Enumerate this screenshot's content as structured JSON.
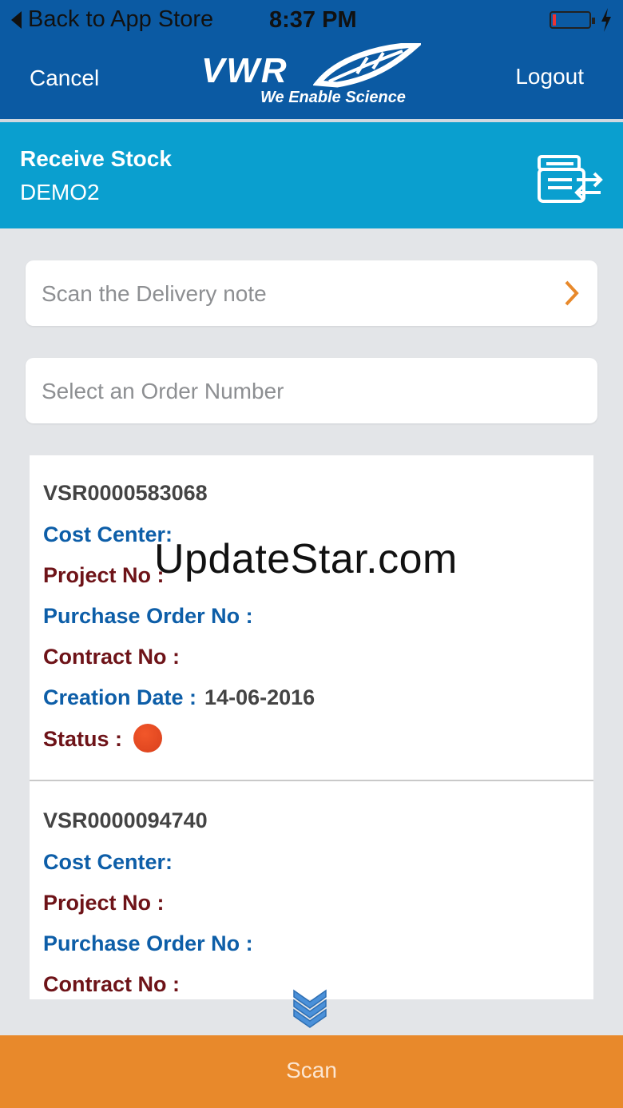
{
  "status_bar": {
    "back_label": "Back to App Store",
    "time": "8:37 PM",
    "battery_level": 0.1
  },
  "nav": {
    "cancel_label": "Cancel",
    "logout_label": "Logout",
    "logo_text": "VWR",
    "logo_tagline": "We Enable Science"
  },
  "header": {
    "title": "Receive Stock",
    "subtitle": "DEMO2",
    "action_icon": "transfer-icon"
  },
  "form": {
    "delivery_placeholder": "Scan the Delivery note",
    "order_placeholder": "Select an Order Number"
  },
  "orders": [
    {
      "id": "VSR0000583068",
      "cost_center_label": "Cost Center:",
      "cost_center_value": "",
      "project_label": "Project No :",
      "project_value": "",
      "po_label": "Purchase Order No :",
      "po_value": "",
      "contract_label": "Contract No :",
      "contract_value": "",
      "date_label": "Creation Date :",
      "date_value": "14-06-2016",
      "status_label": "Status :",
      "status_color": "#d9401c"
    },
    {
      "id": "VSR0000094740",
      "cost_center_label": "Cost Center:",
      "project_label": "Project No :",
      "po_label": "Purchase Order No :",
      "contract_label": "Contract No :"
    }
  ],
  "watermark": "UpdateStar.com",
  "footer": {
    "scan_label": "Scan"
  },
  "colors": {
    "nav_blue": "#0b5aa3",
    "header_cyan": "#0a9fcf",
    "accent_orange": "#e8892b",
    "label_blue": "#0d5ea8",
    "label_maroon": "#6e1318"
  }
}
